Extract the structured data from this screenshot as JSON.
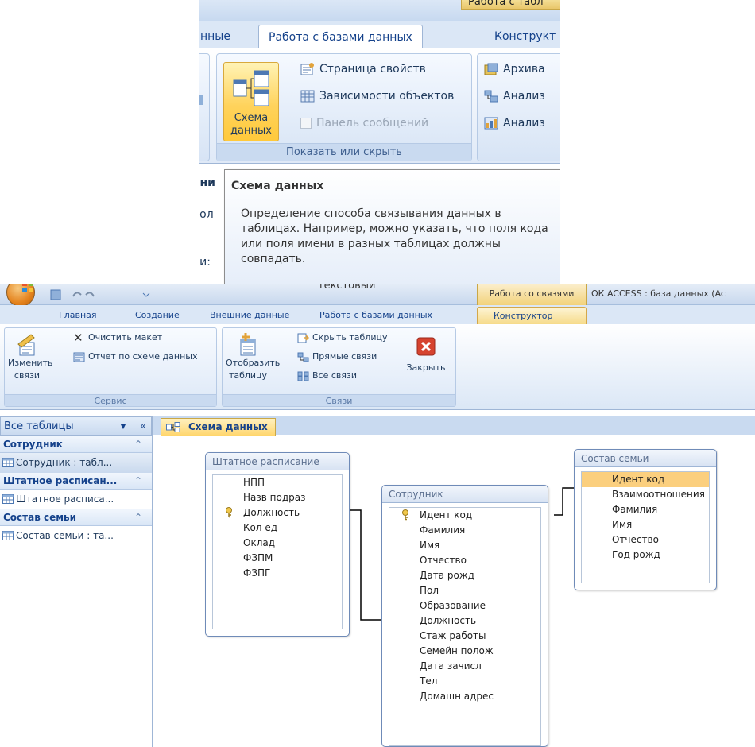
{
  "top": {
    "context_tab": "Работа с табл",
    "tabs": [
      "нные",
      "Работа с базами данных",
      "Конструкт"
    ],
    "group_show_hide": {
      "big_button_lines": [
        "Схема",
        "данных"
      ],
      "items": [
        "Страница свойств",
        "Зависимости объектов",
        "Панель сообщений"
      ],
      "label": "Показать или скрыть"
    },
    "group_right_items": [
      "Архива",
      "Анализ",
      "Анализ"
    ],
    "bg_fragments": [
      "ани",
      "пол",
      "ни:"
    ],
    "tooltip": {
      "title": "Схема данных",
      "body": "Определение способа связывания данных в таблицах. Например, можно указать, что поля кода или поля имени в разных таблицах должны совпадать."
    }
  },
  "window": {
    "context_tab": "Работа со связями",
    "app_title": "ОК ACCESS : база данных (Ac",
    "hidden_header_text": "текстовый",
    "tabs": [
      "Главная",
      "Создание",
      "Внешние данные",
      "Работа с базами данных",
      "Конструктор"
    ],
    "active_tab_index": 4,
    "ribbon": {
      "service": {
        "edit_links": [
          "Изменить",
          "связи"
        ],
        "clear_layout": "Очистить макет",
        "report": "Отчет по схеме данных",
        "label": "Сервис"
      },
      "links": {
        "show_table": [
          "Отобразить",
          "таблицу"
        ],
        "hide_table": "Скрыть таблицу",
        "direct_links": "Прямые связи",
        "all_links": "Все связи",
        "close": "Закрыть",
        "label": "Связи"
      }
    },
    "nav": {
      "header": "Все таблицы",
      "sections": [
        {
          "title": "Сотрудник",
          "item": "Сотрудник : табл...",
          "selected": true
        },
        {
          "title": "Штатное расписан...",
          "item": "Штатное расписа...",
          "selected": false
        },
        {
          "title": "Состав семьи",
          "item": "Состав семьи : та...",
          "selected": false
        }
      ]
    },
    "doc_tab": "Схема данных",
    "tables": {
      "staff": {
        "title": "Штатное расписание",
        "fields": [
          "НПП",
          "Назв подраз",
          "Должность",
          "Кол ед",
          "Оклад",
          "ФЗПМ",
          "ФЗПГ"
        ],
        "key_field": 2
      },
      "employee": {
        "title": "Сотрудник",
        "fields": [
          "Идент код",
          "Фамилия",
          "Имя",
          "Отчество",
          "Дата рожд",
          "Пол",
          "Образование",
          "Должность",
          "Стаж работы",
          "Семейн полож",
          "Дата зачисл",
          "Тел",
          "Домашн адрес"
        ],
        "key_field": 0
      },
      "family": {
        "title": "Состав семьи",
        "fields": [
          "Идент код",
          "Взаимоотношения",
          "Фамилия",
          "Имя",
          "Отчество",
          "Год рожд"
        ],
        "highlight_field": 0
      }
    }
  }
}
